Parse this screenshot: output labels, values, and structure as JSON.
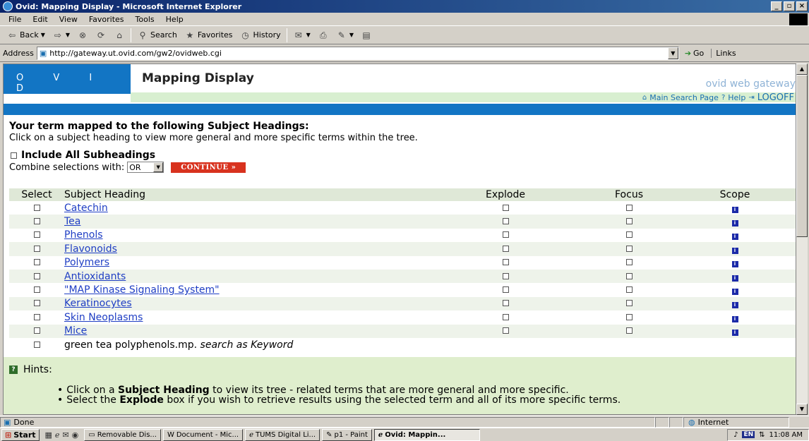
{
  "window": {
    "title": "Ovid: Mapping Display - Microsoft Internet Explorer"
  },
  "menu": [
    "File",
    "Edit",
    "View",
    "Favorites",
    "Tools",
    "Help"
  ],
  "toolbar": {
    "back": "Back",
    "search": "Search",
    "favorites": "Favorites",
    "history": "History"
  },
  "address": {
    "label": "Address",
    "url": "http://gateway.ut.ovid.com/gw2/ovidweb.cgi",
    "go": "Go",
    "links": "Links"
  },
  "page": {
    "logo": "O V I D",
    "title": "Mapping Display",
    "gateway": "ovid web gateway",
    "nav": {
      "main_search": "Main Search Page",
      "help": "Help",
      "logoff": "LOGOFF"
    },
    "intro_heading": "Your term mapped to the following Subject Headings:",
    "intro_text": "Click on a subject heading to view more general and more specific terms within the tree.",
    "include_all": "Include All Subheadings",
    "combine_label": "Combine selections with:",
    "combine_value": "OR",
    "continue": "CONTINUE »",
    "columns": {
      "select": "Select",
      "heading": "Subject Heading",
      "explode": "Explode",
      "focus": "Focus",
      "scope": "Scope"
    },
    "rows": [
      "Catechin",
      "Tea",
      "Phenols",
      "Flavonoids",
      "Polymers",
      "Antioxidants",
      "\"MAP Kinase Signaling System\"",
      "Keratinocytes",
      "Skin Neoplasms",
      "Mice"
    ],
    "keyword_row": {
      "term": "green tea polyphenols.mp.",
      "suffix": "search as Keyword"
    },
    "hints_title": "Hints:",
    "hint1_a": "Click on a ",
    "hint1_b": "Subject Heading",
    "hint1_c": " to view its tree - related terms that are more general and more specific.",
    "hint2_a": "Select the ",
    "hint2_b": "Explode",
    "hint2_c": " box if you wish to retrieve results using the selected term and all of its more specific terms."
  },
  "status": {
    "left": "Done",
    "zone": "Internet"
  },
  "taskbar": {
    "start": "Start",
    "tasks": [
      "Removable Dis...",
      "Document - Mic...",
      "TUMS Digital Li...",
      "p1 - Paint",
      "Ovid: Mappin..."
    ],
    "lang": "EN",
    "clock": "11:08 AM"
  }
}
